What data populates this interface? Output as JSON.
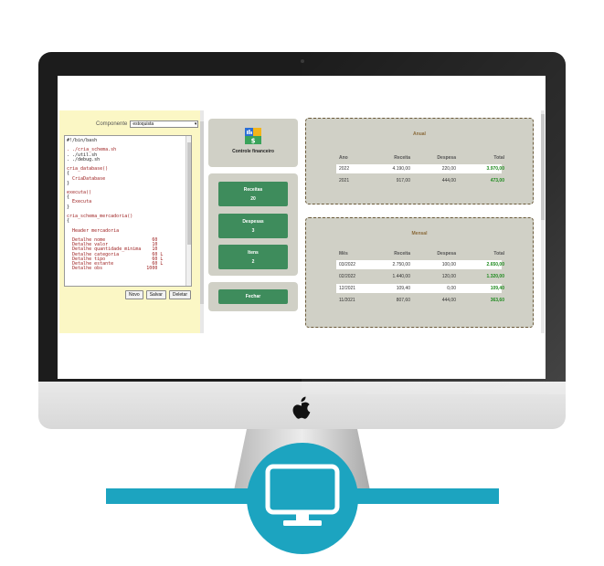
{
  "editor": {
    "component_label": "Componente",
    "component_value": "estoquista",
    "code_lines": [
      "#!/bin/bash",
      "",
      ". ./cria_schema.sh",
      ". ./util.sh",
      ". ./debug.sh",
      "",
      "cria_database()",
      "{",
      "  CriaDatabase",
      "}",
      "",
      "executa()",
      "{",
      "  Executa",
      "}",
      "",
      "cria_schema_mercadoria()",
      "{",
      "",
      "  Header mercadoria",
      "",
      "  Detalhe nome                 60",
      "  Detalhe valor                10",
      "  Detalhe quantidade_minima    10",
      "  Detalhe categoria            60 L",
      "  Detalhe tipo                 60 L",
      "  Detalhe estante              60 L",
      "  Detalhe obs                1000"
    ],
    "buttons": {
      "novo": "Novo",
      "salvar": "Salvar",
      "deletar": "Deletar"
    }
  },
  "app": {
    "title": "Controle financeiro",
    "logo_symbol": "$",
    "menu": [
      {
        "label": "Receitas",
        "count": "20"
      },
      {
        "label": "Despesas",
        "count": "3"
      },
      {
        "label": "Itens",
        "count": "2"
      }
    ],
    "close_label": "Fechar"
  },
  "anual": {
    "title": "Anual",
    "headers": [
      "Ano",
      "Receita",
      "Despesa",
      "Total"
    ],
    "rows": [
      {
        "period": "2022",
        "receita": "4.190,00",
        "despesa": "220,00",
        "total": "3.970,00"
      },
      {
        "period": "2021",
        "receita": "917,00",
        "despesa": "444,00",
        "total": "473,00"
      }
    ]
  },
  "mensal": {
    "title": "Mensal",
    "headers": [
      "Mês",
      "Receita",
      "Despesa",
      "Total"
    ],
    "rows": [
      {
        "period": "03/2022",
        "receita": "2.750,00",
        "despesa": "100,00",
        "total": "2.650,00"
      },
      {
        "period": "02/2022",
        "receita": "1.440,00",
        "despesa": "120,00",
        "total": "1.320,00"
      },
      {
        "period": "12/2021",
        "receita": "109,40",
        "despesa": "0,00",
        "total": "109,40"
      },
      {
        "period": "11/2021",
        "receita": "807,60",
        "despesa": "444,00",
        "total": "363,60"
      }
    ]
  },
  "colors": {
    "accent_green": "#3e8c5c",
    "total_green": "#1e8a1e",
    "card_bg": "#d0d0c6",
    "editor_bg": "#fbf7c5",
    "brand_teal": "#1ca4c0"
  },
  "icons": [
    "apple-logo-icon",
    "monitor-icon",
    "finance-logo-icon",
    "chevron-down-icon"
  ]
}
